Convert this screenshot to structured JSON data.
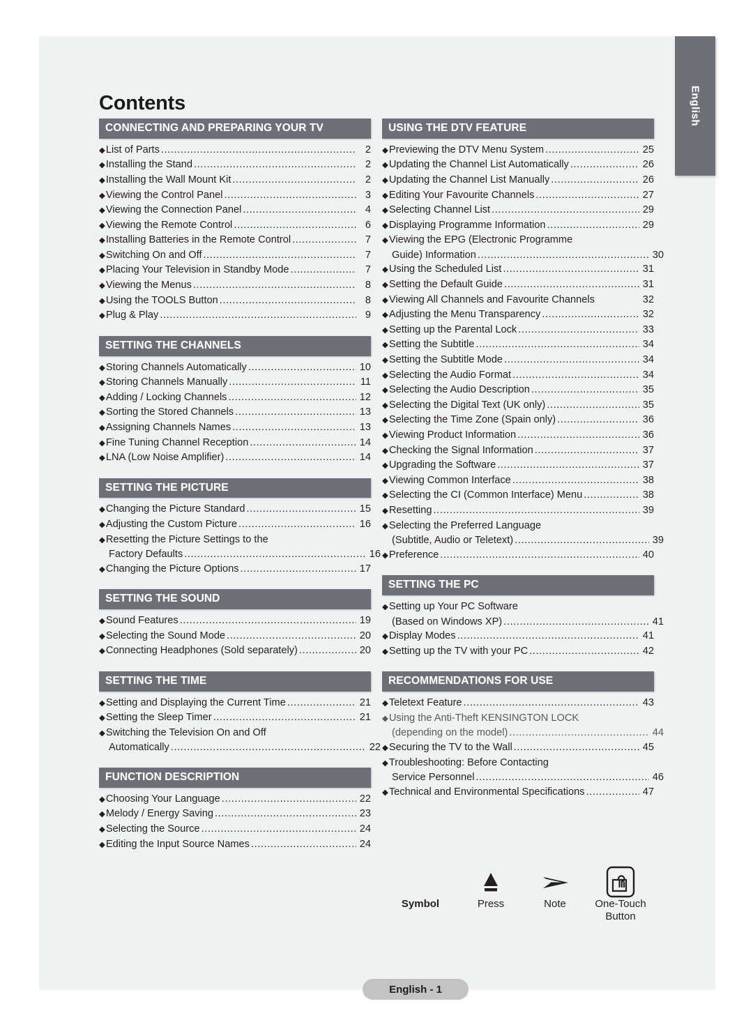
{
  "page": {
    "title": "Contents",
    "language_tab": "English",
    "footer": "English - 1"
  },
  "left_column": [
    {
      "header": "CONNECTING AND PREPARING YOUR TV",
      "entries": [
        {
          "label": "List of Parts",
          "page": "2"
        },
        {
          "label": "Installing the Stand",
          "page": "2"
        },
        {
          "label": "Installing the Wall Mount Kit",
          "page": "2"
        },
        {
          "label": "Viewing the Control Panel",
          "page": "3"
        },
        {
          "label": "Viewing the Connection Panel",
          "page": "4"
        },
        {
          "label": "Viewing the Remote Control",
          "page": "6"
        },
        {
          "label": "Installing Batteries in the Remote Control",
          "page": "7"
        },
        {
          "label": "Switching On and Off",
          "page": "7"
        },
        {
          "label": "Placing Your Television in Standby Mode",
          "page": "7"
        },
        {
          "label": "Viewing the Menus",
          "page": "8"
        },
        {
          "label": "Using the TOOLS Button",
          "page": "8"
        },
        {
          "label": "Plug & Play",
          "page": "9"
        }
      ]
    },
    {
      "header": "SETTING THE CHANNELS",
      "entries": [
        {
          "label": "Storing Channels Automatically",
          "page": "10"
        },
        {
          "label": "Storing Channels Manually",
          "page": "11"
        },
        {
          "label": "Adding / Locking Channels",
          "page": "12"
        },
        {
          "label": "Sorting the Stored Channels",
          "page": "13"
        },
        {
          "label": "Assigning Channels Names",
          "page": "13"
        },
        {
          "label": "Fine Tuning Channel Reception",
          "page": "14"
        },
        {
          "label": "LNA (Low Noise Amplifier)",
          "page": "14"
        }
      ]
    },
    {
      "header": "SETTING THE PICTURE",
      "entries": [
        {
          "label": "Changing the Picture Standard",
          "page": "15"
        },
        {
          "label": "Adjusting the Custom Picture",
          "page": "16"
        },
        {
          "label": "Resetting the Picture Settings to the",
          "label2": "Factory Defaults",
          "page": "16"
        },
        {
          "label": "Changing the Picture Options",
          "page": "17"
        }
      ]
    },
    {
      "header": "SETTING THE SOUND",
      "entries": [
        {
          "label": "Sound Features",
          "page": "19"
        },
        {
          "label": "Selecting the Sound Mode",
          "page": "20"
        },
        {
          "label": "Connecting Headphones (Sold separately)",
          "page": "20"
        }
      ]
    },
    {
      "header": "SETTING THE TIME",
      "entries": [
        {
          "label": "Setting and Displaying the Current Time",
          "page": "21"
        },
        {
          "label": "Setting the Sleep Timer",
          "page": "21"
        },
        {
          "label": "Switching the Television On and Off",
          "label2": "Automatically",
          "page": "22"
        }
      ]
    },
    {
      "header": "FUNCTION DESCRIPTION",
      "entries": [
        {
          "label": "Choosing Your Language",
          "page": "22"
        },
        {
          "label": "Melody / Energy Saving ",
          "page": "23"
        },
        {
          "label": "Selecting the Source",
          "page": "24"
        },
        {
          "label": "Editing the Input Source Names",
          "page": "24"
        }
      ]
    }
  ],
  "right_column": [
    {
      "header": "USING THE DTV FEATURE",
      "entries": [
        {
          "label": "Previewing the DTV Menu System",
          "page": "25"
        },
        {
          "label": "Updating the Channel List Automatically",
          "page": "26"
        },
        {
          "label": "Updating the Channel List Manually",
          "page": "26"
        },
        {
          "label": "Editing Your Favourite Channels",
          "page": "27"
        },
        {
          "label": "Selecting Channel List",
          "page": "29"
        },
        {
          "label": "Displaying Programme Information",
          "page": "29"
        },
        {
          "label": "Viewing the EPG (Electronic Programme",
          "label2": "Guide) Information",
          "page": "30"
        },
        {
          "label": "Using the Scheduled List",
          "page": "31"
        },
        {
          "label": "Setting the Default Guide",
          "page": "31"
        },
        {
          "label": "Viewing All Channels and Favourite Channels",
          "page": "32",
          "noleader": true
        },
        {
          "label": "Adjusting the Menu Transparency",
          "page": "32"
        },
        {
          "label": "Setting up the Parental Lock",
          "page": "33"
        },
        {
          "label": "Setting the Subtitle",
          "page": "34"
        },
        {
          "label": "Setting the Subtitle Mode",
          "page": "34"
        },
        {
          "label": "Selecting the Audio Format",
          "page": "34"
        },
        {
          "label": "Selecting the Audio Description",
          "page": "35"
        },
        {
          "label": "Selecting the Digital Text (UK only)",
          "page": "35"
        },
        {
          "label": "Selecting the Time Zone (Spain only)",
          "page": "36"
        },
        {
          "label": "Viewing Product Information",
          "page": "36"
        },
        {
          "label": "Checking the Signal Information",
          "page": "37"
        },
        {
          "label": "Upgrading the Software",
          "page": "37"
        },
        {
          "label": "Viewing Common Interface",
          "page": "38"
        },
        {
          "label": "Selecting the CI (Common Interface) Menu",
          "page": "38"
        },
        {
          "label": "Resetting",
          "page": "39"
        },
        {
          "label": "Selecting the Preferred Language",
          "label2": "(Subtitle, Audio or Teletext)",
          "page": "39"
        },
        {
          "label": "Preference",
          "page": "40"
        }
      ]
    },
    {
      "header": "SETTING THE PC",
      "entries": [
        {
          "label": "Setting up Your PC Software",
          "label2": "(Based on Windows XP)",
          "page": "41"
        },
        {
          "label": "Display Modes",
          "page": "41"
        },
        {
          "label": "Setting up the TV with your PC",
          "page": "42"
        }
      ]
    },
    {
      "header": "RECOMMENDATIONS FOR USE",
      "entries": [
        {
          "label": "Teletext Feature",
          "page": "43"
        },
        {
          "label": "Using the Anti-Theft KENSINGTON LOCK",
          "label2": "(depending on the model)",
          "page": "44",
          "light": true
        },
        {
          "label": "Securing the TV to the Wall",
          "page": "45"
        },
        {
          "label": "Troubleshooting: Before Contacting",
          "label2": "Service Personnel",
          "page": "46"
        },
        {
          "label": "Technical and Environmental Specifications ",
          "page": "47"
        }
      ]
    }
  ],
  "legend": {
    "items": [
      {
        "label": "Symbol",
        "icon": "none",
        "bold": true
      },
      {
        "label": "Press",
        "icon": "press-triangle-icon",
        "bold": false
      },
      {
        "label": "Note",
        "icon": "note-arrow-icon",
        "bold": false
      },
      {
        "label": "One-Touch",
        "label2": "Button",
        "icon": "one-touch-button-icon",
        "bold": false
      }
    ]
  },
  "colors": {
    "header_gray": "#6e6e76",
    "page_background": "#f0f1f1",
    "text": "#231f20",
    "pill": "#c3c3c3"
  }
}
